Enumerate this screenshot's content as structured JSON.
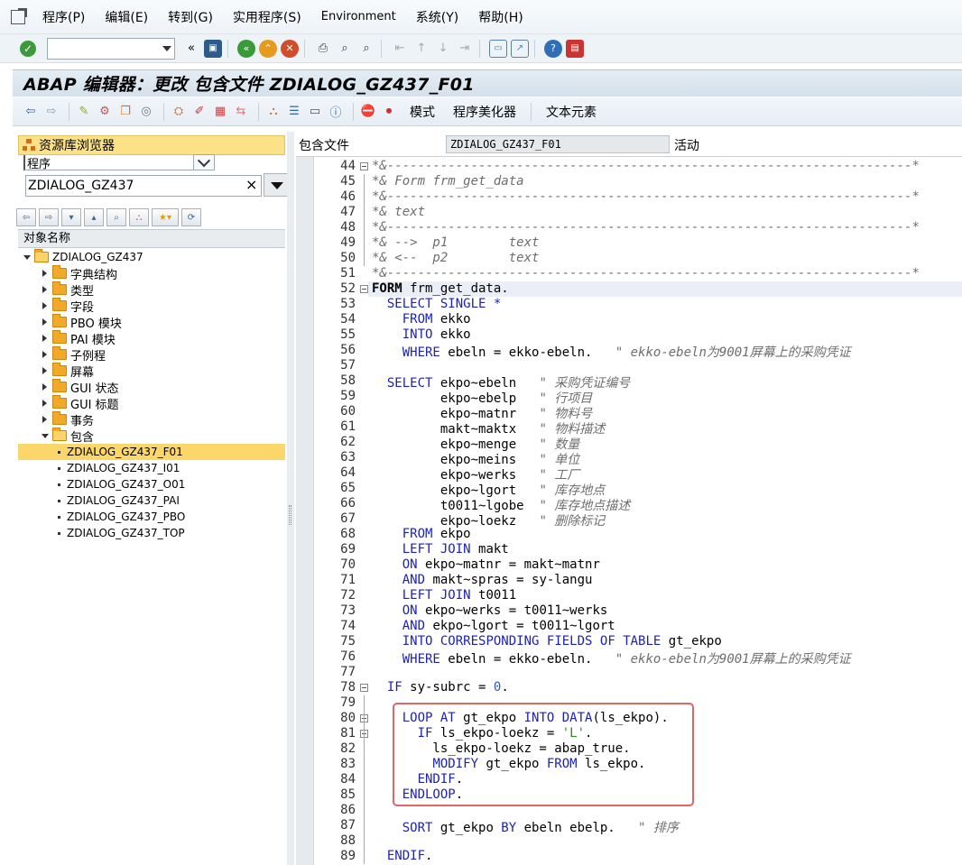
{
  "menubar": {
    "items": [
      "程序(P)",
      "编辑(E)",
      "转到(G)",
      "实用程序(S)",
      "Environment",
      "系统(Y)",
      "帮助(H)"
    ]
  },
  "systoolbar": {
    "command_field": ""
  },
  "title": "ABAP 编辑器：更改 包含文件 ZDIALOG_GZ437_F01",
  "apptoolbar": {
    "mode": "模式",
    "pretty_printer": "程序美化器",
    "text_elements": "文本元素"
  },
  "repo_browser": {
    "header": "资源库浏览器",
    "object_type": "程序",
    "object_name": "ZDIALOG_GZ437",
    "column_header": "对象名称",
    "root": "ZDIALOG_GZ437",
    "nodes": [
      "字典结构",
      "类型",
      "字段",
      "PBO 模块",
      "PAI 模块",
      "子例程",
      "屏幕",
      "GUI 状态",
      "GUI 标题",
      "事务",
      "包含"
    ],
    "includes": [
      "ZDIALOG_GZ437_F01",
      "ZDIALOG_GZ437_I01",
      "ZDIALOG_GZ437_O01",
      "ZDIALOG_GZ437_PAI",
      "ZDIALOG_GZ437_PBO",
      "ZDIALOG_GZ437_TOP"
    ]
  },
  "editor_header": {
    "label": "包含文件",
    "name": "ZDIALOG_GZ437_F01",
    "status": "活动"
  },
  "editor": {
    "line_numbers": [
      "44",
      "45",
      "46",
      "47",
      "48",
      "49",
      "50",
      "51",
      "52",
      "53",
      "54",
      "55",
      "56",
      "57",
      "58",
      "59",
      "60",
      "61",
      "62",
      "63",
      "64",
      "65",
      "66",
      "67",
      "68",
      "69",
      "70",
      "71",
      "72",
      "73",
      "74",
      "75",
      "76",
      "77",
      "78",
      "79",
      "80",
      "81",
      "82",
      "83",
      "84",
      "85",
      "86",
      "87",
      "88",
      "89"
    ],
    "lines": [
      "*&---------------------------------------------------------------------*",
      "*& Form frm_get_data",
      "*&---------------------------------------------------------------------*",
      "*& text",
      "*&---------------------------------------------------------------------*",
      "*& -->  p1        text",
      "*& <--  p2        text",
      "*&---------------------------------------------------------------------*",
      "FORM frm_get_data.",
      "  SELECT SINGLE *",
      "    FROM ekko",
      "    INTO ekko",
      "    WHERE ebeln = ekko-ebeln.   \" ekko-ebeln为9001屏幕上的采购凭证",
      "",
      "  SELECT ekpo~ebeln   \" 采购凭证编号",
      "         ekpo~ebelp   \" 行项目",
      "         ekpo~matnr   \" 物料号",
      "         makt~maktx   \" 物料描述",
      "         ekpo~menge   \" 数量",
      "         ekpo~meins   \" 单位",
      "         ekpo~werks   \" 工厂",
      "         ekpo~lgort   \" 库存地点",
      "         t0011~lgobe  \" 库存地点描述",
      "         ekpo~loekz   \" 删除标记",
      "    FROM ekpo",
      "    LEFT JOIN makt",
      "    ON ekpo~matnr = makt~matnr",
      "    AND makt~spras = sy-langu",
      "    LEFT JOIN t0011",
      "    ON ekpo~werks = t0011~werks",
      "    AND ekpo~lgort = t0011~lgort",
      "    INTO CORRESPONDING FIELDS OF TABLE gt_ekpo",
      "    WHERE ebeln = ekko-ebeln.   \" ekko-ebeln为9001屏幕上的采购凭证",
      "",
      "  IF sy-subrc = 0.",
      "",
      "    LOOP AT gt_ekpo INTO DATA(ls_ekpo).",
      "      IF ls_ekpo-loekz = 'L'.",
      "        ls_ekpo-loekz = abap_true.",
      "        MODIFY gt_ekpo FROM ls_ekpo.",
      "      ENDIF.",
      "    ENDLOOP.",
      "",
      "    SORT gt_ekpo BY ebeln ebelp.   \" 排序",
      "",
      "  ENDIF."
    ]
  }
}
